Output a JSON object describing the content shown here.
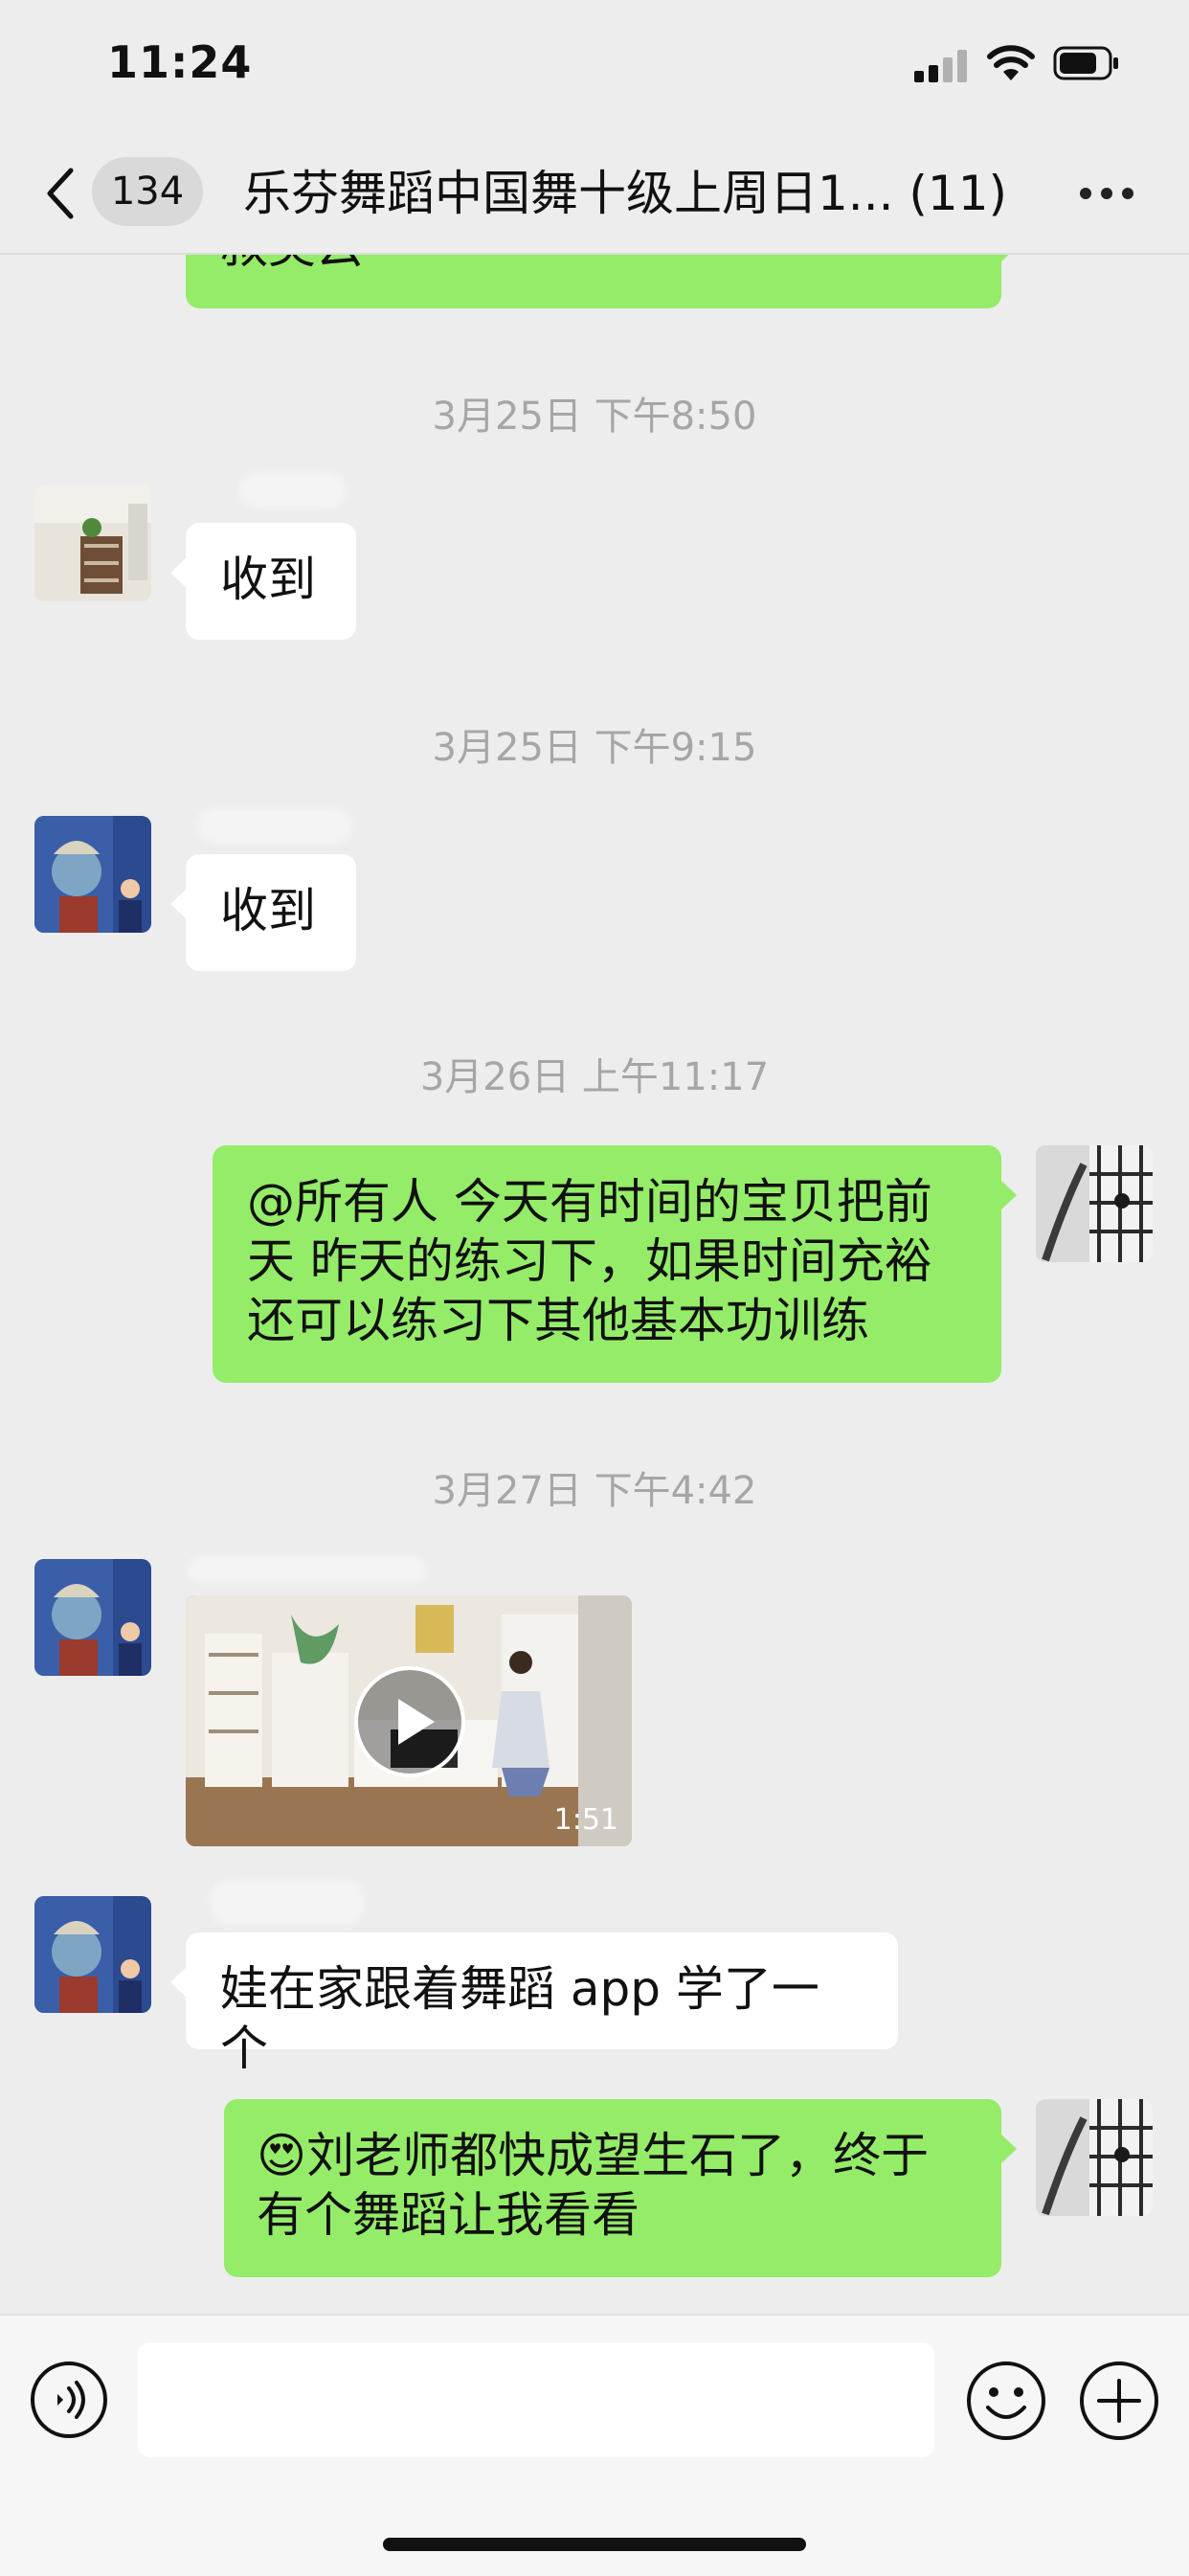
{
  "status_bar": {
    "time": "11:24"
  },
  "header": {
    "unread_count": "134",
    "title": "乐芬舞蹈中国舞十级上周日1... (11)"
  },
  "messages": [
    {
      "type": "outgoing_partial",
      "text": "叔美云"
    },
    {
      "type": "timestamp",
      "text": "3月25日 下午8:50"
    },
    {
      "type": "incoming",
      "text": "收到"
    },
    {
      "type": "timestamp",
      "text": "3月25日 下午9:15"
    },
    {
      "type": "incoming",
      "text": "收到"
    },
    {
      "type": "timestamp",
      "text": "3月26日 上午11:17"
    },
    {
      "type": "outgoing",
      "text": "@所有人  今天有时间的宝贝把前天 昨天的练习下，如果时间充裕还可以练习下其他基本功训练"
    },
    {
      "type": "timestamp",
      "text": "3月27日 下午4:42"
    },
    {
      "type": "incoming_video",
      "duration": "1:51"
    },
    {
      "type": "incoming",
      "text": "娃在家跟着舞蹈 app 学了一个"
    },
    {
      "type": "outgoing",
      "emoji": "😍",
      "text": "刘老师都快成望生石了，终于有个舞蹈让我看看"
    }
  ],
  "input": {
    "placeholder": ""
  },
  "colors": {
    "background": "#ededed",
    "outgoing_bubble": "#95ec69",
    "incoming_bubble": "#ffffff",
    "timestamp": "#a6a6a6"
  },
  "icons": [
    "signal-icon",
    "wifi-icon",
    "battery-icon",
    "back-chevron-icon",
    "more-icon",
    "play-icon",
    "voice-icon",
    "emoji-icon",
    "add-icon"
  ]
}
